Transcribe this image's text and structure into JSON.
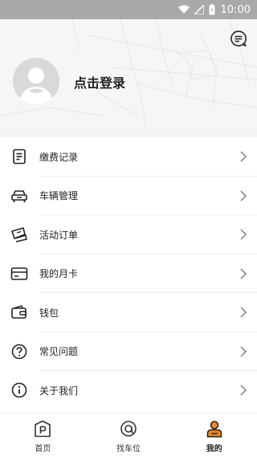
{
  "status_bar": {
    "time": "10:00"
  },
  "profile": {
    "login_text": "点击登录"
  },
  "menu": [
    {
      "label": "缴费记录",
      "icon": "receipt-icon"
    },
    {
      "label": "车辆管理",
      "icon": "car-icon"
    },
    {
      "label": "活动订单",
      "icon": "ticket-icon"
    },
    {
      "label": "我的月卡",
      "icon": "card-icon"
    },
    {
      "label": "钱包",
      "icon": "wallet-icon"
    },
    {
      "label": "常见问题",
      "icon": "question-icon"
    },
    {
      "label": "关于我们",
      "icon": "info-icon"
    }
  ],
  "tabs": [
    {
      "label": "首页",
      "icon": "parking-icon",
      "active": false
    },
    {
      "label": "找车位",
      "icon": "locate-icon",
      "active": false
    },
    {
      "label": "我的",
      "icon": "user-icon",
      "active": true
    }
  ],
  "colors": {
    "accent": "#f08a24",
    "status_bar": "#a9a9a9",
    "header_bg": "#f6f6f6"
  }
}
